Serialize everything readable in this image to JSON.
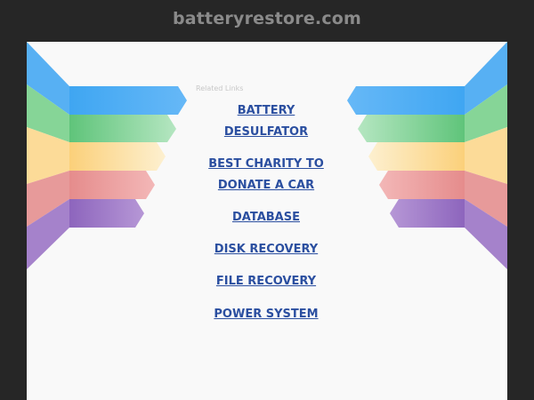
{
  "domain": "batteryrestore.com",
  "related_label": "Related Links",
  "links": [
    {
      "line1": "BATTERY",
      "line2": "DESULFATOR"
    },
    {
      "line1": "BEST CHARITY TO",
      "line2": "DONATE A CAR"
    },
    {
      "line1": "DATABASE"
    },
    {
      "line1": "DISK RECOVERY"
    },
    {
      "line1": "FILE RECOVERY"
    },
    {
      "line1": "POWER SYSTEM"
    }
  ],
  "colors": {
    "background": "#262626",
    "panel": "#f9f9f9",
    "link": "#2b4fa0",
    "domain_text": "#8a8a8a",
    "wing_blue": "#5ab6f5",
    "wing_green": "#7dd08e",
    "wing_yellow": "#fbd88e",
    "wing_red": "#ea8f8f",
    "wing_purple": "#9b78c4"
  }
}
